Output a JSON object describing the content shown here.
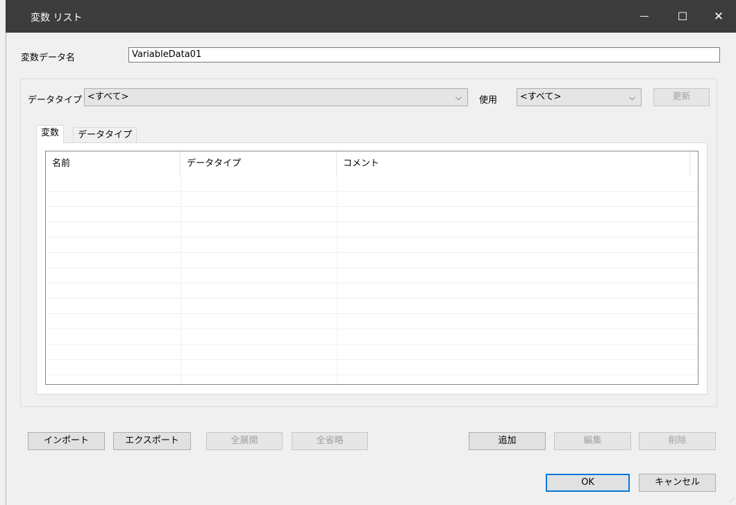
{
  "window": {
    "title": "変数 リスト",
    "minimize_glyph": "—",
    "maximize_glyph": "☐",
    "close_glyph": "✕"
  },
  "variable_data_name": {
    "label": "変数データ名",
    "value": "VariableData01"
  },
  "filters": {
    "data_type_label": "データタイプ",
    "data_type_value": "<すべて>",
    "usage_label": "使用",
    "usage_value": "<すべて>",
    "refresh_label": "更新",
    "dropdown_glyph": "⌵"
  },
  "tabs": [
    {
      "label": "変数",
      "active": true
    },
    {
      "label": "データタイプ",
      "active": false
    }
  ],
  "table": {
    "columns": [
      "名前",
      "データタイプ",
      "コメント"
    ],
    "rows": []
  },
  "buttons": {
    "import": "インポート",
    "export": "エクスポート",
    "expand_all": "全展開",
    "collapse_all": "全省略",
    "add": "追加",
    "edit": "編集",
    "delete": "削除",
    "ok": "OK",
    "cancel": "キャンセル"
  }
}
